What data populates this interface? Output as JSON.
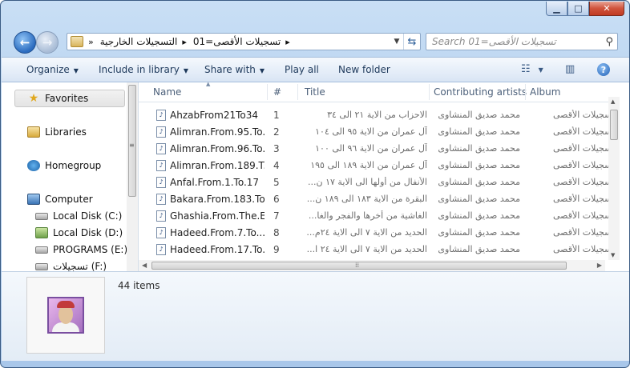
{
  "window": {
    "caption_buttons": [
      "minimize",
      "maximize",
      "close"
    ]
  },
  "address": {
    "chevron": "»",
    "crumbs": [
      "التسجيلات الخارجية",
      "تسجيلات الأقصى=01"
    ],
    "separator": "▸"
  },
  "search": {
    "placeholder": "Search تسجيلات الأقصى=01"
  },
  "toolbar": {
    "organize": "Organize",
    "include": "Include in library",
    "share": "Share with",
    "play": "Play all",
    "new_folder": "New folder"
  },
  "navpane": {
    "items": [
      {
        "label": "Favorites",
        "icon": "star-icon"
      },
      {
        "label": "Libraries",
        "icon": "libraries-icon"
      },
      {
        "label": "Homegroup",
        "icon": "homegroup-icon"
      },
      {
        "label": "Computer",
        "icon": "computer-icon"
      },
      {
        "label": "Local Disk (C:)",
        "icon": "drive-icon"
      },
      {
        "label": "Local Disk (D:)",
        "icon": "drive-icon"
      },
      {
        "label": "PROGRAMS (E:)",
        "icon": "drive-icon"
      },
      {
        "label": "تسجيلات (F:)",
        "icon": "drive-icon"
      }
    ]
  },
  "columns": [
    "Name",
    "#",
    "Title",
    "Contributing artists",
    "Album"
  ],
  "files": [
    {
      "name": "AhzabFrom21To34",
      "num": "1",
      "title": "الاحزاب من الاية ٢١ الى ٣٤",
      "artist": "محمد صديق المنشاوى",
      "album": "تسجيلات الأقصى"
    },
    {
      "name": "Alimran.From.95.To...",
      "num": "2",
      "title": "آل عمران من الاية ٩٥ الى ١٠٤",
      "artist": "محمد صديق المنشاوى",
      "album": "تسجيلات الأقصى"
    },
    {
      "name": "Alimran.From.96.To...",
      "num": "3",
      "title": "آل عمران من الاية ٩٦ الى ١٠٠",
      "artist": "محمد صديق المنشاوى",
      "album": "تسجيلات الأقصى"
    },
    {
      "name": "Alimran.From.189.T...",
      "num": "4",
      "title": "آل عمران من الاية ١٨٩ الى ١٩٥",
      "artist": "محمد صديق المنشاوى",
      "album": "تسجيلات الأقصى"
    },
    {
      "name": "Anfal.From.1.To.17",
      "num": "5",
      "title": "الأنفال من أولها الى الاية ١٧ ن...",
      "artist": "محمد صديق المنشاوى",
      "album": "تسجيلات الأقصى"
    },
    {
      "name": "Bakara.From.183.To...",
      "num": "6",
      "title": "البقرة من الاية ١٨٣ الى ١٨٩ ن...",
      "artist": "محمد صديق المنشاوى",
      "album": "تسجيلات الأقصى"
    },
    {
      "name": "Ghashia.From.The.E...",
      "num": "7",
      "title": "الغاشية من أخرها والفجر والغا...",
      "artist": "محمد صديق المنشاوى",
      "album": "تسجيلات الأقصى"
    },
    {
      "name": "Hadeed.From.7.To...",
      "num": "8",
      "title": "الحديد من الاية ٧ الى الاية ٢٤م...",
      "artist": "محمد صديق المنشاوى",
      "album": "تسجيلات الأقصى"
    },
    {
      "name": "Hadeed.From.17.To...",
      "num": "9",
      "title": "الحديد من الاية ٧ الى الاية ٢٤ ا...",
      "artist": "محمد صديق المنشاوى",
      "album": "تسجيلات الأقصى"
    }
  ],
  "details": {
    "count": "44 items"
  }
}
